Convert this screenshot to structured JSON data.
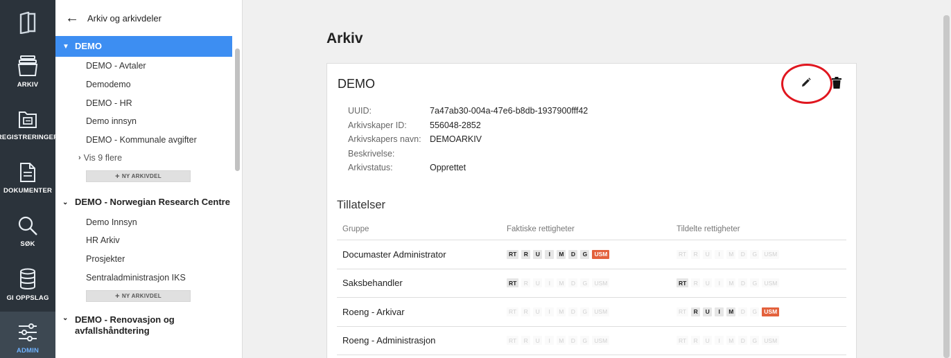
{
  "rail": {
    "items": [
      {
        "label": "ARKIV",
        "icon": "archive-box-icon"
      },
      {
        "label": "REGISTRERINGER",
        "icon": "folder-card-icon"
      },
      {
        "label": "DOKUMENTER",
        "icon": "document-icon"
      },
      {
        "label": "SØK",
        "icon": "search-icon"
      },
      {
        "label": "GI OPPSLAG",
        "icon": "database-icon"
      },
      {
        "label": "ADMIN",
        "icon": "sliders-icon"
      }
    ]
  },
  "tree": {
    "header": "Arkiv og arkivdeler",
    "groups": [
      {
        "title": "DEMO",
        "children": [
          "DEMO - Avtaler",
          "Demodemo",
          "DEMO - HR",
          "Demo innsyn",
          "DEMO - Kommunale avgifter"
        ],
        "more": "Vis 9 flere",
        "new_btn": "NY ARKIVDEL"
      },
      {
        "title": "DEMO - Norwegian Research Centre",
        "children": [
          "Demo Innsyn",
          "HR Arkiv",
          "Prosjekter",
          "Sentraladministrasjon IKS"
        ],
        "new_btn": "NY ARKIVDEL"
      },
      {
        "title_line1": "DEMO - Renovasjon og",
        "title_line2": "avfallshåndtering"
      }
    ]
  },
  "main": {
    "page_title": "Arkiv",
    "card": {
      "title": "DEMO",
      "meta": [
        {
          "k": "UUID:",
          "v": "7a47ab30-004a-47e6-b8db-1937900fff42"
        },
        {
          "k": "Arkivskaper ID:",
          "v": "556048-2852"
        },
        {
          "k": "Arkivskapers navn:",
          "v": "DEMOARKIV"
        },
        {
          "k": "Beskrivelse:",
          "v": ""
        },
        {
          "k": "Arkivstatus:",
          "v": "Opprettet"
        }
      ],
      "permissions_title": "Tillatelser",
      "columns": [
        "Gruppe",
        "Faktiske rettigheter",
        "Tildelte rettigheter"
      ],
      "chip_labels": [
        "RT",
        "R",
        "U",
        "I",
        "M",
        "D",
        "G",
        "USM"
      ],
      "rows": [
        {
          "group": "Documaster Administrator",
          "actual": [
            "on",
            "on",
            "on",
            "on",
            "on",
            "on",
            "on",
            "hot"
          ],
          "assigned": [
            "off",
            "off",
            "off",
            "off",
            "off",
            "off",
            "off",
            "off"
          ]
        },
        {
          "group": "Saksbehandler",
          "actual": [
            "on",
            "off",
            "off",
            "off",
            "off",
            "off",
            "off",
            "off"
          ],
          "assigned": [
            "on",
            "off",
            "off",
            "off",
            "off",
            "off",
            "off",
            "off"
          ]
        },
        {
          "group": "Roeng - Arkivar",
          "actual": [
            "off",
            "off",
            "off",
            "off",
            "off",
            "off",
            "off",
            "off"
          ],
          "assigned": [
            "off",
            "on",
            "on",
            "on",
            "on",
            "off",
            "off",
            "hot"
          ]
        },
        {
          "group": "Roeng - Administrasjon",
          "actual": [
            "off",
            "off",
            "off",
            "off",
            "off",
            "off",
            "off",
            "off"
          ],
          "assigned": [
            "off",
            "off",
            "off",
            "off",
            "off",
            "off",
            "off",
            "off"
          ]
        }
      ]
    }
  }
}
